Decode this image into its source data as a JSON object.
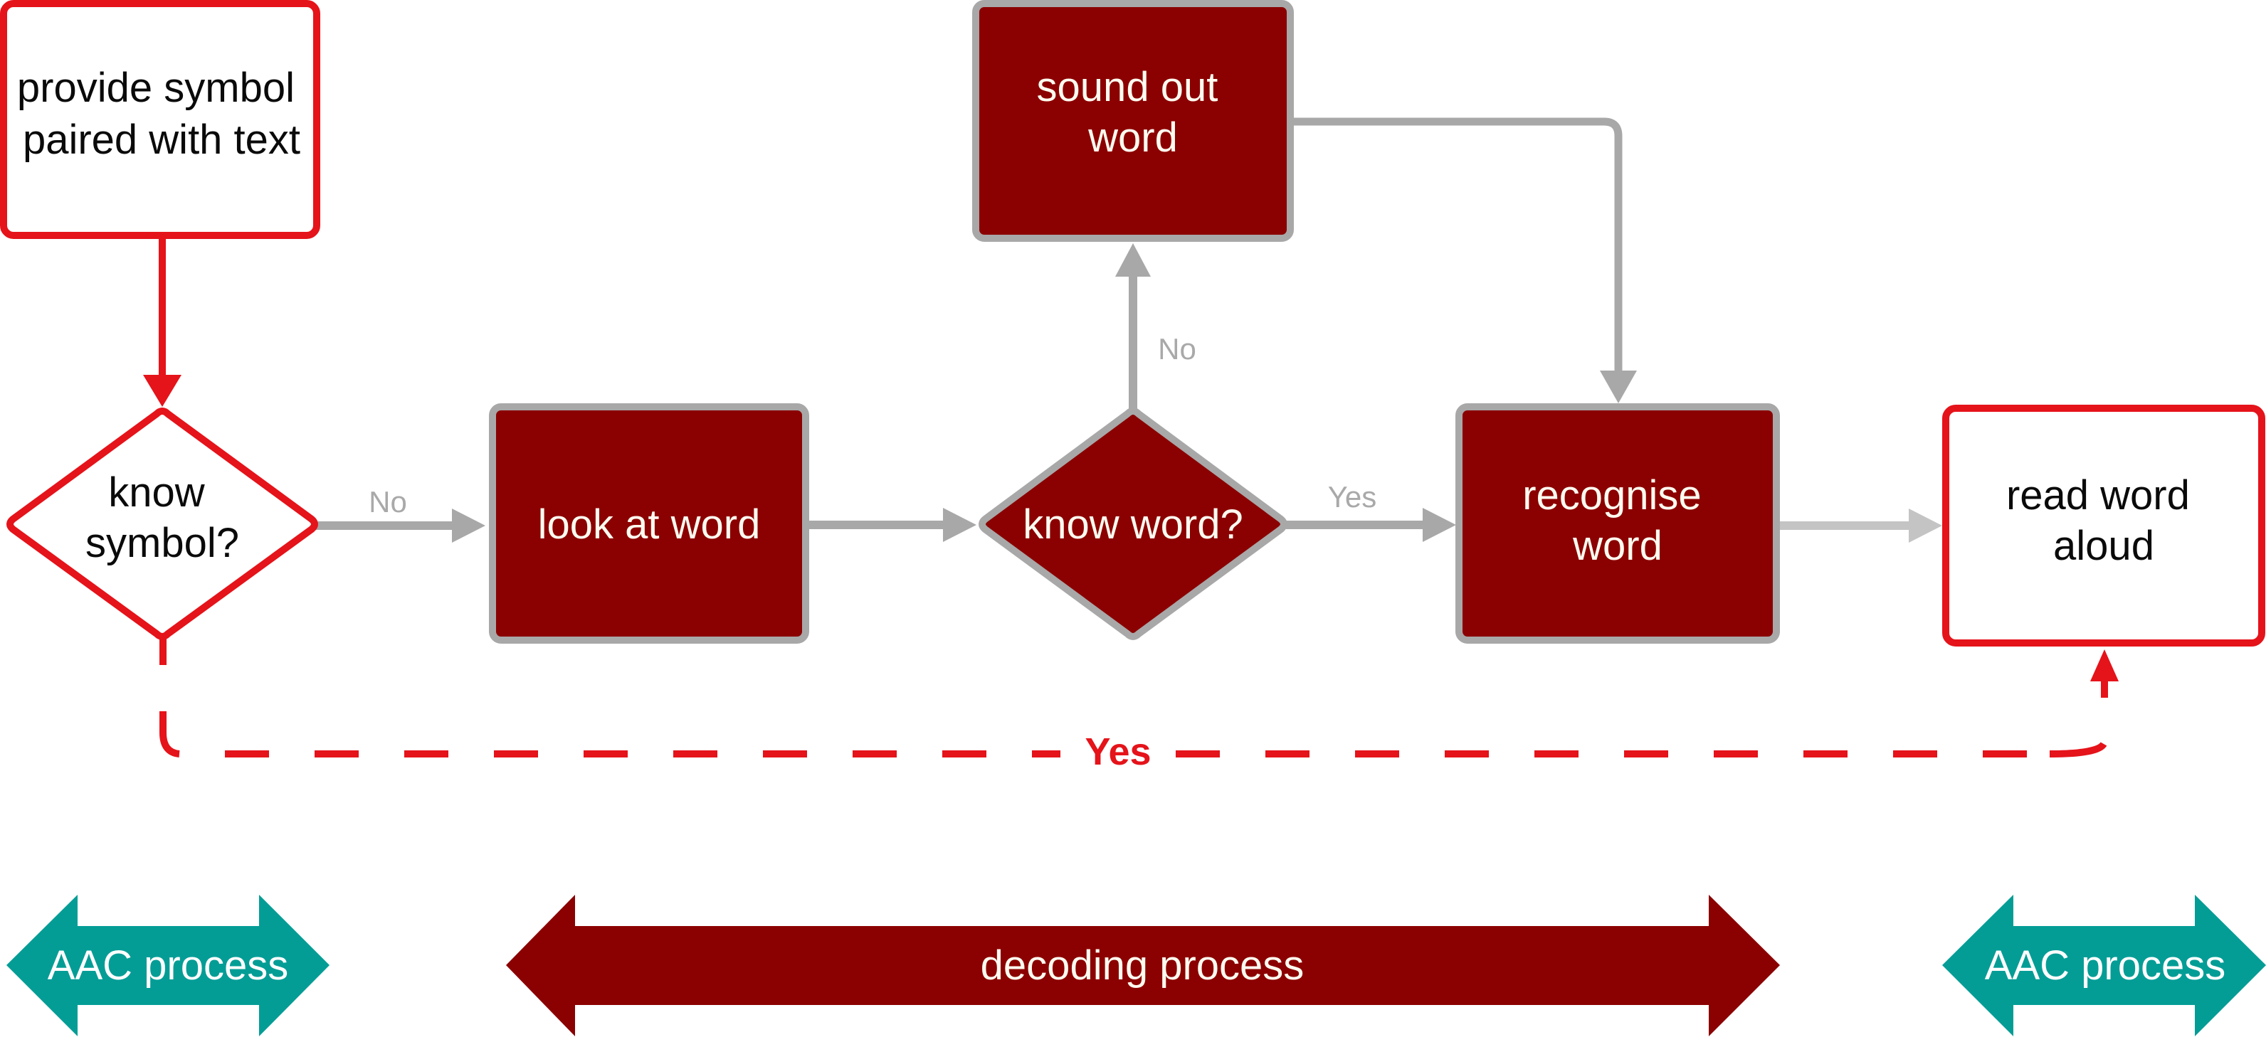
{
  "colors": {
    "dark_red": "#8b0000",
    "gray": "#a8a8a8",
    "light_gray": "#c4c4c4",
    "red": "#e5131a",
    "teal": "#049d96",
    "white": "#ffffff"
  },
  "nodes": {
    "provide_symbol": {
      "lines": [
        "provide symbol",
        "paired with text"
      ],
      "style": "outlined-red"
    },
    "know_symbol": {
      "lines": [
        "know",
        "symbol?"
      ],
      "style": "decision-outlined-red"
    },
    "look_at_word": {
      "lines": [
        "look at word"
      ],
      "style": "filled-dark-red"
    },
    "know_word": {
      "lines": [
        "know word?"
      ],
      "style": "decision-filled-dark-red"
    },
    "sound_out_word": {
      "lines": [
        "sound out",
        "word"
      ],
      "style": "filled-dark-red"
    },
    "recognise_word": {
      "lines": [
        "recognise",
        "word"
      ],
      "style": "filled-dark-red"
    },
    "read_word_aloud": {
      "lines": [
        "read word",
        "aloud"
      ],
      "style": "outlined-red"
    }
  },
  "edges": [
    {
      "from": "provide_symbol",
      "to": "know_symbol",
      "label": "",
      "style": "solid-red"
    },
    {
      "from": "know_symbol",
      "to": "look_at_word",
      "label": "No",
      "style": "solid-gray"
    },
    {
      "from": "look_at_word",
      "to": "know_word",
      "label": "",
      "style": "solid-gray"
    },
    {
      "from": "know_word",
      "to": "sound_out_word",
      "label": "No",
      "style": "solid-gray"
    },
    {
      "from": "know_word",
      "to": "recognise_word",
      "label": "Yes",
      "style": "solid-gray"
    },
    {
      "from": "sound_out_word",
      "to": "recognise_word",
      "label": "",
      "style": "solid-gray"
    },
    {
      "from": "recognise_word",
      "to": "read_word_aloud",
      "label": "",
      "style": "solid-light-gray"
    },
    {
      "from": "know_symbol",
      "to": "read_word_aloud",
      "label": "Yes",
      "style": "dashed-red"
    }
  ],
  "labels": {
    "no_symbol": "No",
    "no_word": "No",
    "yes_word": "Yes",
    "yes_symbol": "Yes"
  },
  "bands": [
    {
      "label": "AAC process",
      "color": "teal"
    },
    {
      "label": "decoding process",
      "color": "dark_red"
    },
    {
      "label": "AAC process",
      "color": "teal"
    }
  ]
}
